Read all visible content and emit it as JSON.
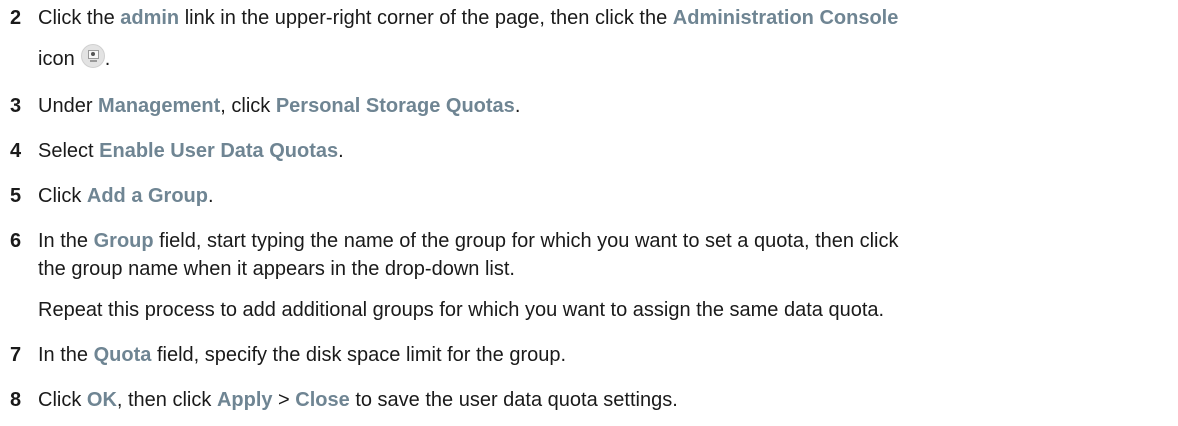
{
  "steps": [
    {
      "num": "2",
      "line1": [
        {
          "t": "Click the "
        },
        {
          "t": "admin",
          "ui": true
        },
        {
          "t": " link in the upper-right corner of the page, then click the "
        },
        {
          "t": "Administration Console",
          "ui": true
        }
      ],
      "line2": [
        {
          "t": "icon"
        }
      ],
      "line2_tail": "."
    },
    {
      "num": "3",
      "parts": [
        {
          "t": "Under "
        },
        {
          "t": "Management",
          "ui": true
        },
        {
          "t": ", click "
        },
        {
          "t": "Personal Storage Quotas",
          "ui": true
        },
        {
          "t": "."
        }
      ]
    },
    {
      "num": "4",
      "parts": [
        {
          "t": "Select "
        },
        {
          "t": "Enable User Data Quotas",
          "ui": true
        },
        {
          "t": "."
        }
      ]
    },
    {
      "num": "5",
      "parts": [
        {
          "t": "Click "
        },
        {
          "t": "Add a Group",
          "ui": true
        },
        {
          "t": "."
        }
      ]
    },
    {
      "num": "6",
      "parts": [
        {
          "t": "In the "
        },
        {
          "t": "Group",
          "ui": true
        },
        {
          "t": " field, start typing the name of the group for which you want to set a quota, then click"
        }
      ],
      "line2": "the group name when it appears in the drop-down list.",
      "note": "Repeat this process to add additional groups for which you want to assign the same data quota."
    },
    {
      "num": "7",
      "parts": [
        {
          "t": "In the "
        },
        {
          "t": "Quota",
          "ui": true
        },
        {
          "t": " field, specify the disk space limit for the group."
        }
      ]
    },
    {
      "num": "8",
      "parts": [
        {
          "t": "Click "
        },
        {
          "t": "OK",
          "ui": true
        },
        {
          "t": ", then click "
        },
        {
          "t": "Apply",
          "ui": true
        },
        {
          "t": " > "
        },
        {
          "t": "Close",
          "ui": true
        },
        {
          "t": " to save the user data quota settings."
        }
      ]
    }
  ],
  "icon": "administration-console-icon",
  "colors": {
    "ui_label": "#6f8593",
    "text": "#1a1a1a"
  }
}
